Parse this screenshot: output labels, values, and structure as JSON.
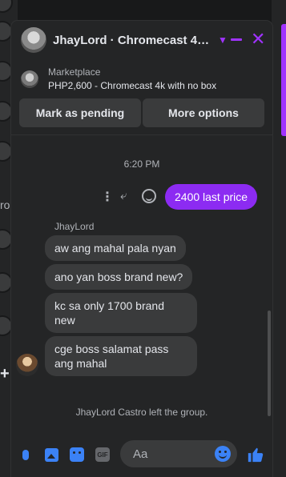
{
  "header": {
    "title": "JhayLord · Chromecast 4k...",
    "accent_color": "#a033ff"
  },
  "marketplace": {
    "label": "Marketplace",
    "item": "PHP2,600 - Chromecast 4k with no box"
  },
  "actions": {
    "mark_pending": "Mark as pending",
    "more_options": "More options"
  },
  "conversation": {
    "timestamp": "6:20 PM",
    "outgoing": {
      "text": "2400 last price",
      "bubble_color": "#8c2bf2"
    },
    "incoming": {
      "sender": "JhayLord",
      "messages": [
        "aw ang mahal pala nyan",
        "ano yan boss brand new?",
        "kc sa only 1700 brand new",
        "cge boss salamat pass ang mahal"
      ]
    },
    "system_message": "JhayLord Castro left the group."
  },
  "left_strip": {
    "partial_text": "ro"
  },
  "composer": {
    "placeholder": "Aa",
    "gif_label": "GIF",
    "icons": [
      "microphone-icon",
      "image-icon",
      "sticker-icon",
      "gif-icon",
      "emoji-icon",
      "thumbs-up-icon"
    ],
    "icon_color": "#3b82f6"
  }
}
